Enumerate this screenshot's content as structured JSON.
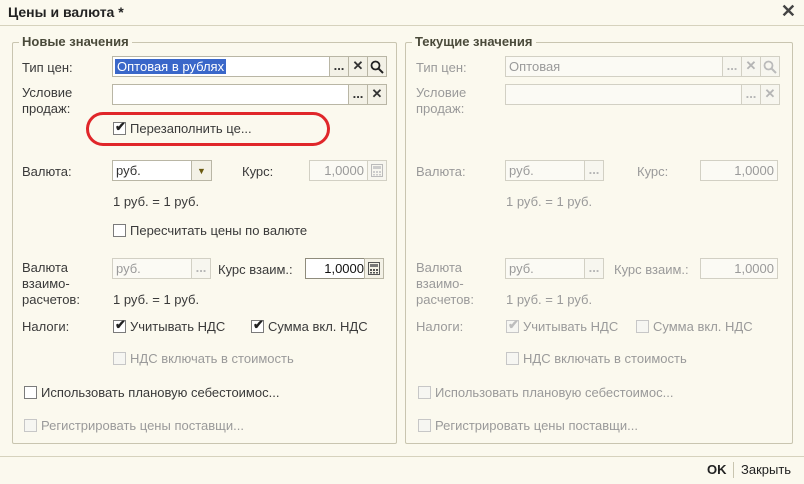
{
  "window": {
    "title": "Цены и валюта *"
  },
  "new_values": {
    "legend": "Новые значения",
    "price_type": {
      "label": "Тип цен:",
      "value": "Оптовая в рублях"
    },
    "sale_condition": {
      "label": "Условие\nпродаж:",
      "value": ""
    },
    "refill_prices": {
      "label": "Перезаполнить це...",
      "checked": true
    },
    "currency": {
      "label": "Валюта:",
      "value": "руб."
    },
    "rate": {
      "label": "Курс:",
      "value": "1,0000"
    },
    "rate_note": "1 руб. = 1 руб.",
    "recalc_prices": {
      "label": "Пересчитать цены по валюте",
      "checked": false
    },
    "settlement_currency": {
      "label": "Валюта\nвзаимо-\nрасчетов:",
      "value": "руб."
    },
    "settlement_rate": {
      "label": "Курс взаим.:",
      "value": "1,0000"
    },
    "settlement_note": "1 руб. = 1 руб.",
    "taxes": {
      "label": "Налоги:",
      "consider_vat": {
        "label": "Учитывать НДС",
        "checked": true
      },
      "sum_incl_vat": {
        "label": "Сумма вкл. НДС",
        "checked": true
      },
      "vat_in_cost": {
        "label": "НДС включать в стоимость",
        "checked": false
      }
    },
    "use_planned_cost": {
      "label": "Использовать плановую себестоимос...",
      "checked": false
    },
    "register_supplier_prices": {
      "label": "Регистрировать цены поставщи...",
      "checked": false
    }
  },
  "current_values": {
    "legend": "Текущие значения",
    "price_type": {
      "label": "Тип цен:",
      "value": "Оптовая"
    },
    "sale_condition": {
      "label": "Условие\nпродаж:",
      "value": ""
    },
    "currency": {
      "label": "Валюта:",
      "value": "руб."
    },
    "rate": {
      "label": "Курс:",
      "value": "1,0000"
    },
    "rate_note": "1 руб. = 1 руб.",
    "settlement_currency": {
      "label": "Валюта\nвзаимо-\nрасчетов:",
      "value": "руб."
    },
    "settlement_rate": {
      "label": "Курс взаим.:",
      "value": "1,0000"
    },
    "settlement_note": "1 руб. = 1 руб.",
    "taxes": {
      "label": "Налоги:",
      "consider_vat": {
        "label": "Учитывать НДС",
        "checked": true
      },
      "sum_incl_vat": {
        "label": "Сумма вкл. НДС",
        "checked": false
      },
      "vat_in_cost": {
        "label": "НДС включать в стоимость",
        "checked": false
      }
    },
    "use_planned_cost": {
      "label": "Использовать плановую себестоимос...",
      "checked": false
    },
    "register_supplier_prices": {
      "label": "Регистрировать цены поставщи...",
      "checked": false
    }
  },
  "buttons": {
    "ok": "OK",
    "close": "Закрыть"
  },
  "icons": {
    "select": "...",
    "clear": "✕",
    "search": "search-icon",
    "calculator": "calculator-icon",
    "dropdown": "▼"
  },
  "colors": {
    "selection": "#3a67c9",
    "highlight_oval": "#e0262a",
    "background": "#fbf9ee"
  }
}
